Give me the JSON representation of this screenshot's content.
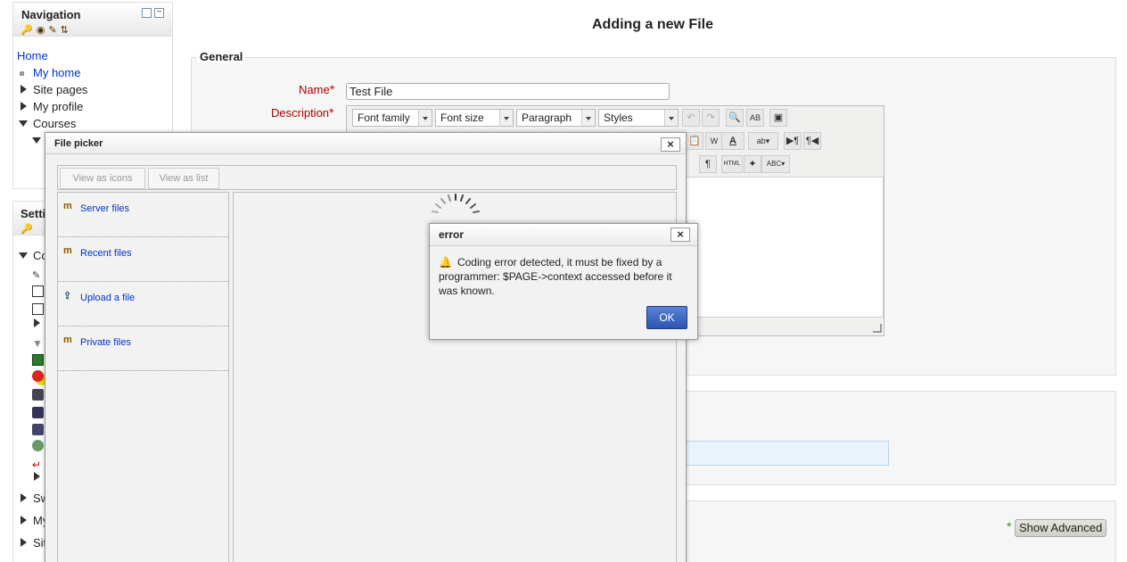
{
  "navigation": {
    "title": "Navigation",
    "items": [
      {
        "label": "Home",
        "type": "link"
      },
      {
        "label": "My home",
        "type": "link"
      },
      {
        "label": "Site pages",
        "type": "collapsed"
      },
      {
        "label": "My profile",
        "type": "collapsed"
      },
      {
        "label": "Courses",
        "type": "expanded"
      }
    ]
  },
  "settings": {
    "title": "Setti",
    "items": [
      {
        "label": "Co",
        "type": "expanded"
      },
      {
        "label": "Sw",
        "type": "collapsed"
      },
      {
        "label": "My",
        "type": "collapsed"
      },
      {
        "label": "Sit",
        "type": "collapsed"
      }
    ]
  },
  "page": {
    "title": "Adding a new File",
    "section_general": "General",
    "name_label": "Name",
    "name_value": "Test File",
    "description_label": "Description",
    "required_mark": "*",
    "show_advanced": "Show Advanced"
  },
  "editor": {
    "font_family": "Font family",
    "font_size": "Font size",
    "format": "Paragraph",
    "styles": "Styles"
  },
  "file_picker": {
    "title": "File picker",
    "view_icons": "View as icons",
    "view_list": "View as list",
    "repositories": [
      {
        "label": "Server files",
        "icon": "moodle-icon"
      },
      {
        "label": "Recent files",
        "icon": "moodle-icon"
      },
      {
        "label": "Upload a file",
        "icon": "upload-icon"
      },
      {
        "label": "Private files",
        "icon": "moodle-icon"
      }
    ]
  },
  "error_dialog": {
    "title": "error",
    "message": "Coding error detected, it must be fixed by a programmer: $PAGE->context accessed before it was known.",
    "ok_label": "OK",
    "close_label": "×"
  },
  "colors": {
    "link": "#0033cc",
    "required": "#cc0000",
    "ok_button": "#2d55b0"
  }
}
